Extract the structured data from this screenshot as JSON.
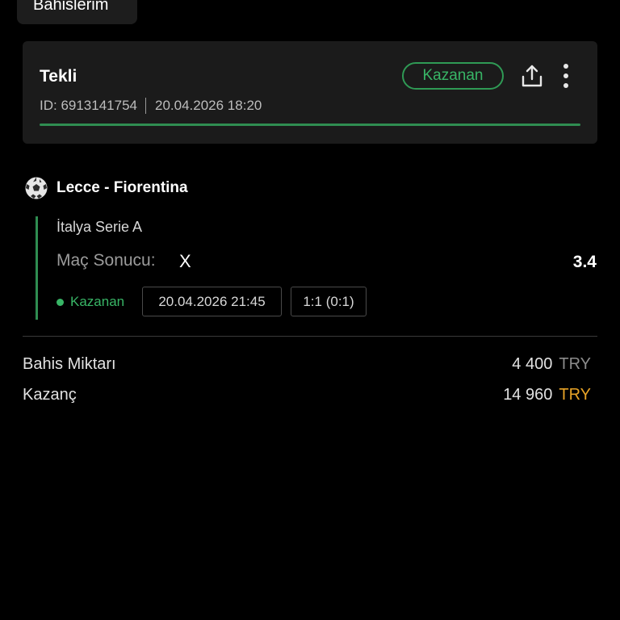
{
  "header": {
    "tab_label": "Bahislerim"
  },
  "bet": {
    "type": "Tekli",
    "status": "Kazanan",
    "id_text": "ID: 6913141754",
    "placed_at": "20.04.2026 18:20",
    "progress": 1.0
  },
  "icons": {
    "share": "share-icon",
    "more": "more-vertical-icon",
    "sport": "football-icon"
  },
  "event": {
    "match": "Lecce - Fiorentina",
    "league": "İtalya Serie A",
    "market": "Maç Sonucu:",
    "selection": "X",
    "odds": "3.4",
    "leg_status": "Kazanan",
    "start_time": "20.04.2026 21:45",
    "score": "1:1 (0:1)"
  },
  "summary": {
    "stake_label": "Bahis Miktarı",
    "stake_amount": "4 400",
    "stake_currency": "TRY",
    "win_label": "Kazanç",
    "win_amount": "14 960",
    "win_currency": "TRY"
  },
  "colors": {
    "background": "#000000",
    "card": "#1b1b1b",
    "accent_green": "#38b566",
    "currency_gold": "#e9a427"
  }
}
